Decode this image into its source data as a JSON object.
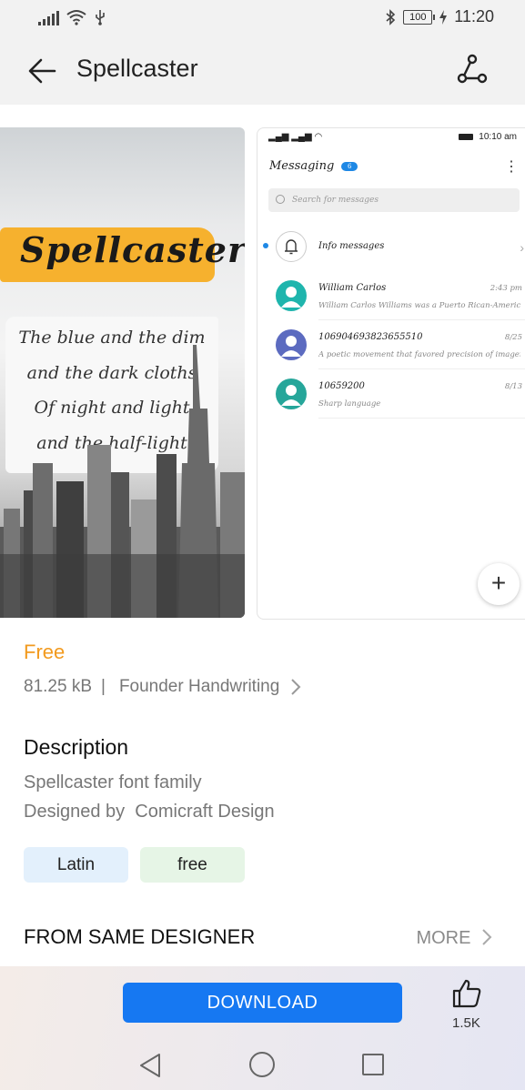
{
  "status_bar": {
    "time": "11:20",
    "battery": "100",
    "icons": [
      "signal-icon",
      "wifi-icon",
      "usb-icon",
      "bluetooth-icon",
      "battery-icon",
      "charging-icon"
    ]
  },
  "app_bar": {
    "title": "Spellcaster",
    "back_icon": "arrow-left-icon",
    "share_icon": "share-icon"
  },
  "preview": {
    "poster_title": "Spellcaster",
    "poster_lines": [
      "The blue and the dim",
      "and the dark cloths",
      "Of night and light",
      "and the half-light"
    ],
    "phone": {
      "time": "10:10 am",
      "app_title": "Messaging",
      "badge": "6",
      "search_placeholder": "Search for messages",
      "conversations": [
        {
          "name": "Info messages",
          "message": "",
          "date": "",
          "avatar": "bell-icon"
        },
        {
          "name": "William Carlos",
          "message": "William Carlos Williams was a Puerto Rican-American poet",
          "date": "2:43 pm",
          "color": "#1fb5ad"
        },
        {
          "name": "106904693823655510",
          "message": "A poetic movement that favored precision of imagery and...",
          "date": "8/25",
          "color": "#5c6bc0"
        },
        {
          "name": "10659200",
          "message": "Sharp language",
          "date": "8/13",
          "color": "#26a69a"
        }
      ],
      "fab": "+"
    }
  },
  "details": {
    "price": "Free",
    "size": "81.25 kB",
    "separator": "|",
    "foundry": "Founder Handwriting",
    "description_heading": "Description",
    "description_line1": "Spellcaster font family",
    "description_line2": "Designed by  Comicraft Design",
    "tags": [
      "Latin",
      "free"
    ],
    "same_designer_heading": "FROM SAME DESIGNER",
    "more_label": "MORE"
  },
  "bottom_bar": {
    "download_label": "DOWNLOAD",
    "like_count": "1.5K"
  },
  "colors": {
    "accent": "#1678f2",
    "price": "#f29a1e",
    "brush": "#f6b12e"
  }
}
